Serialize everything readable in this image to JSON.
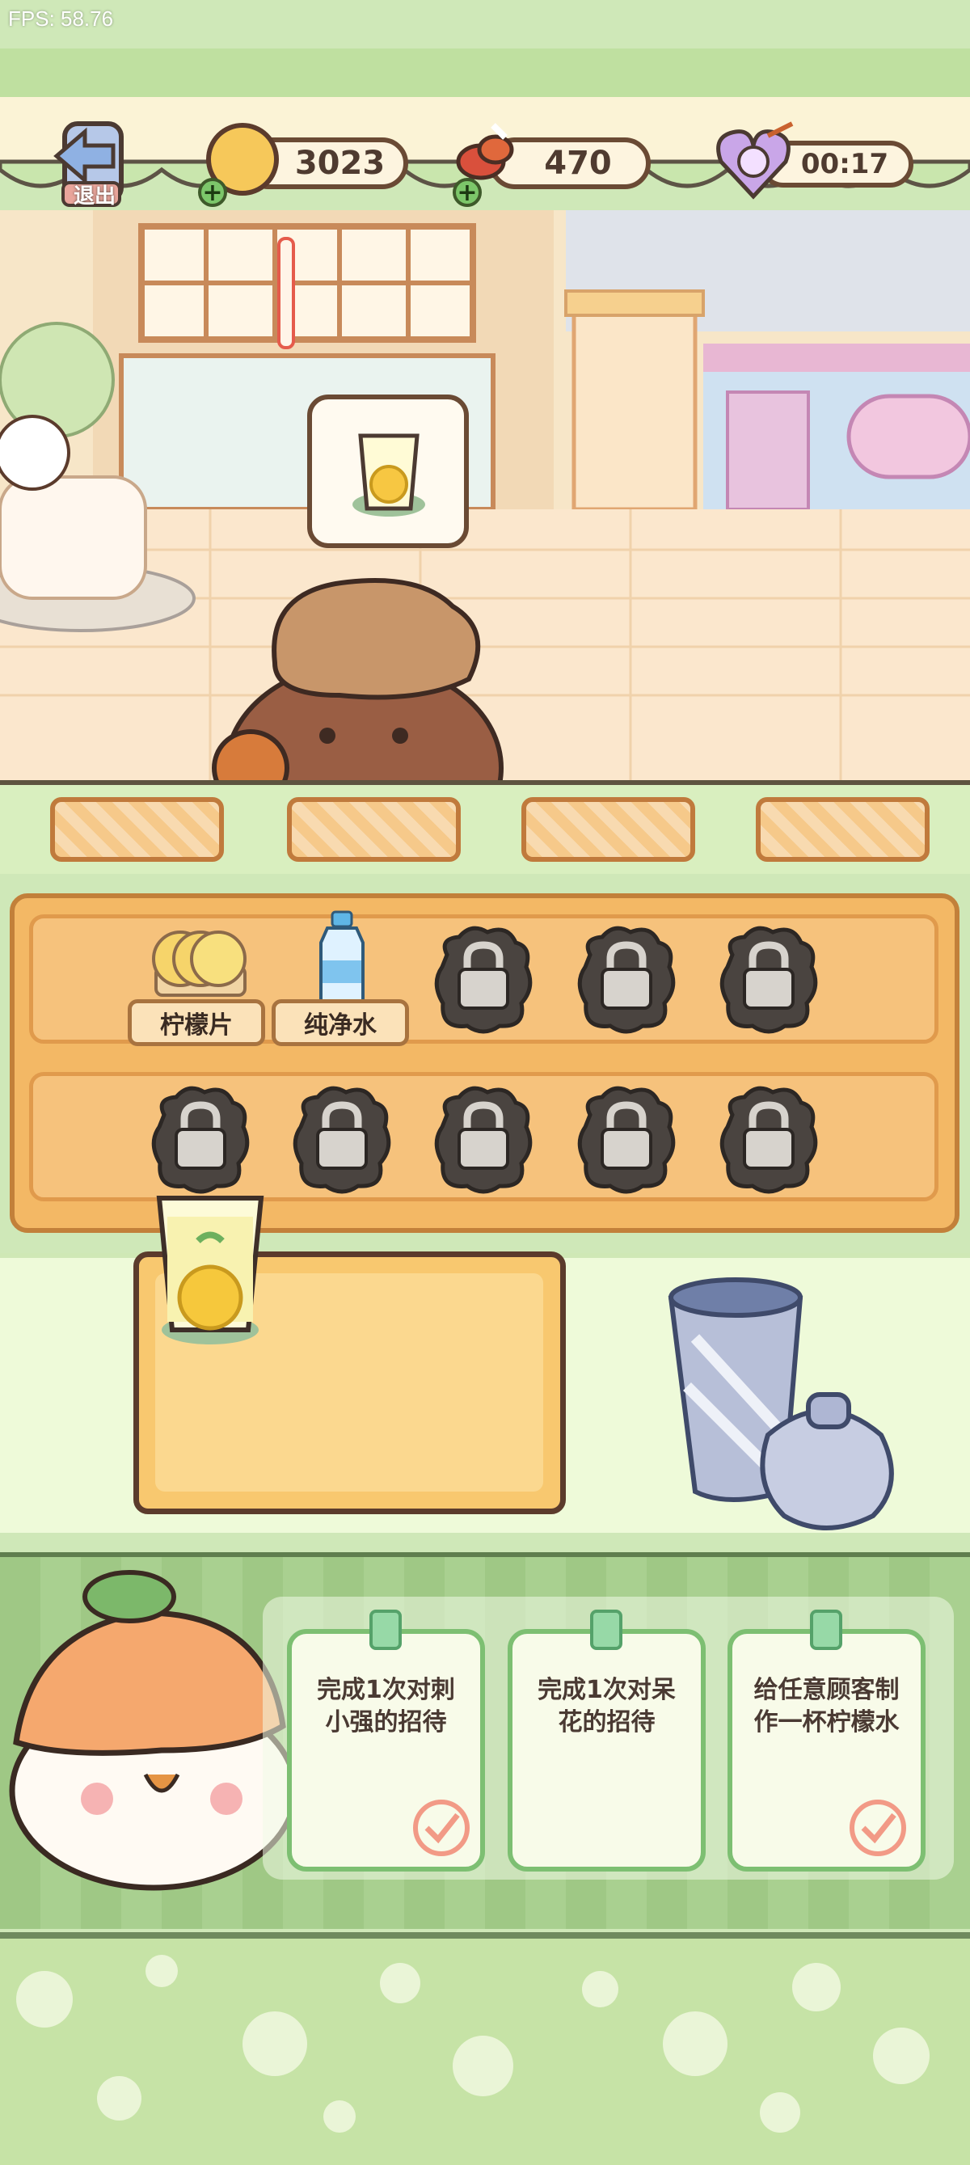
{
  "fps": "FPS: 58.76",
  "topbar": {
    "exit_label": "退出",
    "coins": "3023",
    "ingredients": "470",
    "timer": "00:17"
  },
  "order": {
    "item_icon": "lemon-water-icon"
  },
  "shelf": {
    "items": [
      {
        "label": "柠檬片",
        "icon": "lemon-slices-icon"
      },
      {
        "label": "纯净水",
        "icon": "water-bottle-icon"
      }
    ],
    "locked_slots": 8
  },
  "tasks": [
    {
      "text_line1": "完成1次对刺",
      "text_line2": "小强的招待"
    },
    {
      "text_line1": "完成1次对呆",
      "text_line2": "花的招待"
    },
    {
      "text_line1": "给任意顾客制",
      "text_line2": "作一杯柠檬水"
    }
  ]
}
